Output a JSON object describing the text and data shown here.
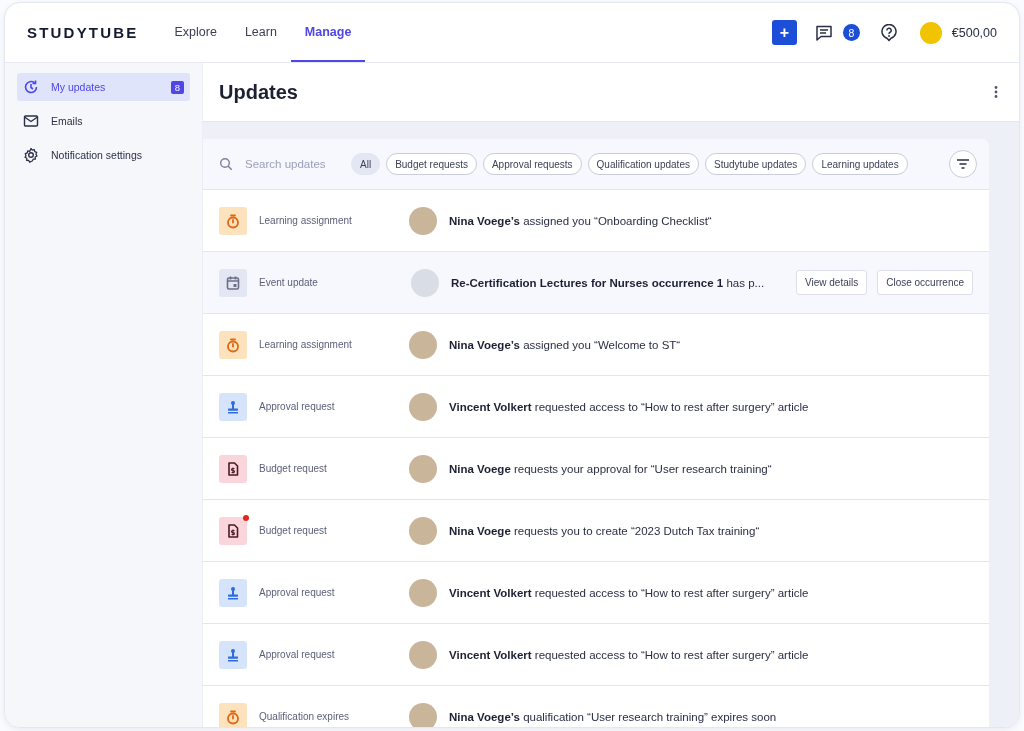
{
  "header": {
    "logo": "STUDYTUBE",
    "nav": [
      {
        "label": "Explore",
        "selected": false
      },
      {
        "label": "Learn",
        "selected": false
      },
      {
        "label": "Manage",
        "selected": true
      }
    ],
    "add_button": "+",
    "messages_badge": "8",
    "balance": "€500,00"
  },
  "sidebar": {
    "items": [
      {
        "kind": "updates",
        "label": "My updates",
        "badge": "8",
        "selected": true
      },
      {
        "kind": "mail",
        "label": "Emails",
        "selected": false
      },
      {
        "kind": "settings",
        "label": "Notification settings",
        "selected": false
      }
    ]
  },
  "page": {
    "title": "Updates"
  },
  "toolbar": {
    "search": {
      "placeholder": "Search updates"
    },
    "filters": [
      {
        "label": "All",
        "selected": true
      },
      {
        "label": "Budget requests",
        "selected": false
      },
      {
        "label": "Approval requests",
        "selected": false
      },
      {
        "label": "Qualification updates",
        "selected": false
      },
      {
        "label": "Studytube updates",
        "selected": false
      },
      {
        "label": "Learning updates",
        "selected": false
      }
    ]
  },
  "updates": [
    {
      "kind": "learning",
      "type": "Learning assignment",
      "message": "**Nina Voege’s** assigned you “Onboarding Checklist“",
      "unread": false,
      "highlighted": false
    },
    {
      "kind": "event",
      "type": "Event update",
      "message": "**Re-Certification Lectures for Nurses occurrence 1** has p...",
      "unread": false,
      "highlighted": true,
      "actions": [
        "View details",
        "Close occurrence"
      ]
    },
    {
      "kind": "learning",
      "type": "Learning assignment",
      "message": "**Nina Voege’s** assigned you “Welcome to ST“",
      "unread": false,
      "highlighted": false
    },
    {
      "kind": "approval",
      "type": "Approval request",
      "message": "**Vincent Volkert** requested access to “How to rest after surgery” article",
      "unread": false,
      "highlighted": false
    },
    {
      "kind": "budget",
      "type": "Budget request",
      "message": "**Nina Voege** requests your approval for “User research training“",
      "unread": false,
      "highlighted": false
    },
    {
      "kind": "budget",
      "type": "Budget request",
      "message": "**Nina Voege** requests you  to create “2023 Dutch Tax training“",
      "unread": true,
      "highlighted": false
    },
    {
      "kind": "approval",
      "type": "Approval request",
      "message": "**Vincent Volkert** requested access to “How to rest after surgery” article",
      "unread": false,
      "highlighted": false
    },
    {
      "kind": "approval",
      "type": "Approval request",
      "message": "**Vincent Volkert** requested access to “How to rest after surgery” article",
      "unread": false,
      "highlighted": false
    },
    {
      "kind": "qualification",
      "type": "Qualification expires",
      "message": "**Nina Voege’s** qualification “User research training” expires soon",
      "unread": false,
      "highlighted": false
    }
  ]
}
